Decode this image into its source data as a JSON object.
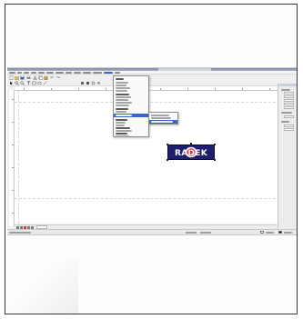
{
  "logo": {
    "text": "RADEK"
  },
  "colors": {
    "logo_background": "#1f1f6e",
    "logo_text": "#ffffff",
    "logo_accent": "#e8232a",
    "menu_highlight": "#3a67c4",
    "title_bar": "#7d8aa6",
    "canvas": "#ffffff",
    "workspace": "#f0f0f0"
  },
  "icons": {
    "new": "new-document-icon",
    "open": "open-folder-icon",
    "save": "save-icon",
    "print": "print-icon",
    "cut": "cut-icon",
    "copy": "copy-icon",
    "paste": "paste-icon",
    "undo": "undo-icon",
    "redo": "redo-icon",
    "zoom_in": "zoom-in-icon",
    "zoom_out": "zoom-out-icon",
    "pointer": "pointer-icon",
    "text": "text-tool-icon"
  }
}
